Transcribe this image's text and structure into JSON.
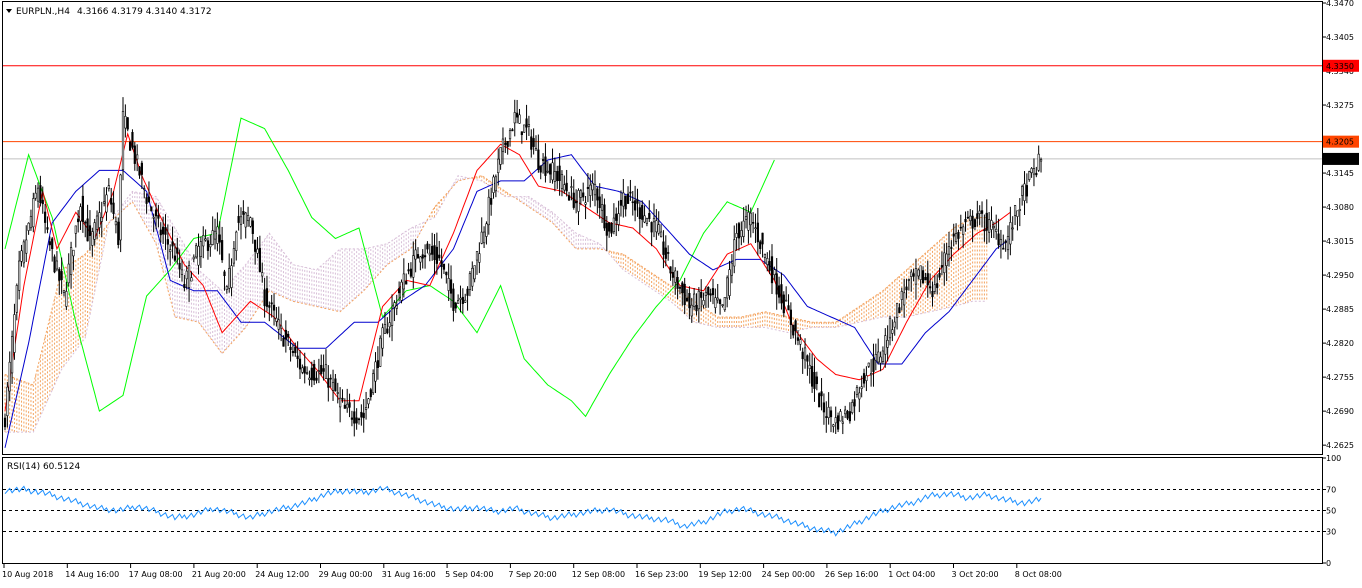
{
  "header": {
    "symbol": "EURPLN.,H4",
    "ohlc": "4.3166 4.3179 4.3140 4.3172"
  },
  "rsi_panel": {
    "label": "RSI(14) 60.5124",
    "ticks": [
      "100",
      "70",
      "50",
      "30",
      "0"
    ]
  },
  "price_axis": {
    "ticks": [
      "4.3470",
      "4.3405",
      "4.3340",
      "4.3275",
      "4.3210",
      "4.3145",
      "4.3080",
      "4.3015",
      "4.2950",
      "4.2885",
      "4.2820",
      "4.2755",
      "4.2690",
      "4.2625"
    ]
  },
  "time_axis": {
    "labels": [
      "10 Aug 2018",
      "14 Aug 16:00",
      "17 Aug 08:00",
      "21 Aug 20:00",
      "24 Aug 12:00",
      "29 Aug 00:00",
      "31 Aug 16:00",
      "5 Sep 04:00",
      "7 Sep 20:00",
      "12 Sep 08:00",
      "16 Sep 23:00",
      "19 Sep 12:00",
      "24 Sep 00:00",
      "26 Sep 16:00",
      "1 Oct 04:00",
      "3 Oct 20:00",
      "8 Oct 08:00"
    ]
  },
  "levels": [
    {
      "label": "4.3350",
      "value": 4.335,
      "color": "#ff0000"
    },
    {
      "label": "4.3205",
      "value": 4.3205,
      "color": "#ff4500"
    }
  ],
  "current_price": {
    "label": "4.3172",
    "value": 4.3172
  },
  "colors": {
    "bull_candle": "#000000",
    "bear_candle": "#000000",
    "tenkan": "#ff0000",
    "kijun": "#0000cd",
    "chikou": "#00ff00",
    "cloud_bull": "#f4a460",
    "cloud_bear": "#d8bfd8",
    "rsi": "#1e90ff",
    "level_red": "#ff0000",
    "level_orange": "#ff4500"
  },
  "chart_data": {
    "type": "candlestick",
    "symbol": "EURPLN",
    "timeframe": "H4",
    "ylim": [
      4.261,
      4.347
    ],
    "rsi_levels": [
      30,
      50,
      70
    ],
    "rsi_ylim": [
      0,
      100
    ],
    "anchors": {
      "close": [
        [
          0,
          4.268
        ],
        [
          6,
          4.296
        ],
        [
          14,
          4.312
        ],
        [
          18,
          4.302
        ],
        [
          25,
          4.291
        ],
        [
          32,
          4.309
        ],
        [
          36,
          4.301
        ],
        [
          44,
          4.311
        ],
        [
          48,
          4.302
        ],
        [
          50,
          4.325
        ],
        [
          56,
          4.316
        ],
        [
          60,
          4.31
        ],
        [
          65,
          4.304
        ],
        [
          72,
          4.299
        ],
        [
          76,
          4.293
        ],
        [
          82,
          4.3
        ],
        [
          90,
          4.303
        ],
        [
          94,
          4.291
        ],
        [
          98,
          4.305
        ],
        [
          104,
          4.306
        ],
        [
          110,
          4.291
        ],
        [
          117,
          4.284
        ],
        [
          126,
          4.277
        ],
        [
          136,
          4.276
        ],
        [
          144,
          4.269
        ],
        [
          152,
          4.268
        ],
        [
          160,
          4.283
        ],
        [
          168,
          4.293
        ],
        [
          176,
          4.3
        ],
        [
          184,
          4.298
        ],
        [
          190,
          4.29
        ],
        [
          196,
          4.292
        ],
        [
          204,
          4.306
        ],
        [
          210,
          4.318
        ],
        [
          216,
          4.325
        ],
        [
          222,
          4.322
        ],
        [
          226,
          4.317
        ],
        [
          234,
          4.314
        ],
        [
          242,
          4.309
        ],
        [
          250,
          4.312
        ],
        [
          256,
          4.303
        ],
        [
          262,
          4.31
        ],
        [
          270,
          4.307
        ],
        [
          276,
          4.304
        ],
        [
          282,
          4.296
        ],
        [
          290,
          4.289
        ],
        [
          298,
          4.291
        ],
        [
          304,
          4.288
        ],
        [
          310,
          4.303
        ],
        [
          316,
          4.306
        ],
        [
          322,
          4.299
        ],
        [
          328,
          4.292
        ],
        [
          334,
          4.285
        ],
        [
          340,
          4.278
        ],
        [
          346,
          4.27
        ],
        [
          352,
          4.267
        ],
        [
          358,
          4.269
        ],
        [
          364,
          4.276
        ],
        [
          370,
          4.279
        ],
        [
          376,
          4.286
        ],
        [
          382,
          4.293
        ],
        [
          388,
          4.295
        ],
        [
          394,
          4.292
        ],
        [
          400,
          4.301
        ],
        [
          406,
          4.304
        ],
        [
          412,
          4.306
        ],
        [
          418,
          4.304
        ],
        [
          424,
          4.301
        ],
        [
          430,
          4.309
        ],
        [
          435,
          4.314
        ],
        [
          439,
          4.317
        ]
      ],
      "tenkan": [
        [
          0,
          4.269
        ],
        [
          8,
          4.293
        ],
        [
          16,
          4.311
        ],
        [
          22,
          4.3
        ],
        [
          30,
          4.307
        ],
        [
          38,
          4.302
        ],
        [
          46,
          4.311
        ],
        [
          52,
          4.322
        ],
        [
          58,
          4.314
        ],
        [
          66,
          4.306
        ],
        [
          76,
          4.297
        ],
        [
          84,
          4.293
        ],
        [
          92,
          4.284
        ],
        [
          104,
          4.29
        ],
        [
          114,
          4.287
        ],
        [
          124,
          4.281
        ],
        [
          132,
          4.277
        ],
        [
          142,
          4.271
        ],
        [
          150,
          4.271
        ],
        [
          160,
          4.289
        ],
        [
          170,
          4.294
        ],
        [
          180,
          4.293
        ],
        [
          190,
          4.303
        ],
        [
          200,
          4.315
        ],
        [
          210,
          4.32
        ],
        [
          218,
          4.318
        ],
        [
          226,
          4.312
        ],
        [
          236,
          4.311
        ],
        [
          246,
          4.308
        ],
        [
          256,
          4.305
        ],
        [
          266,
          4.304
        ],
        [
          276,
          4.3
        ],
        [
          286,
          4.293
        ],
        [
          296,
          4.292
        ],
        [
          306,
          4.299
        ],
        [
          316,
          4.301
        ],
        [
          326,
          4.294
        ],
        [
          334,
          4.285
        ],
        [
          344,
          4.279
        ],
        [
          352,
          4.276
        ],
        [
          362,
          4.275
        ],
        [
          372,
          4.277
        ],
        [
          382,
          4.286
        ],
        [
          392,
          4.294
        ],
        [
          402,
          4.299
        ],
        [
          412,
          4.303
        ],
        [
          420,
          4.305
        ],
        [
          426,
          4.307
        ]
      ],
      "kijun": [
        [
          0,
          4.262
        ],
        [
          10,
          4.282
        ],
        [
          20,
          4.305
        ],
        [
          30,
          4.311
        ],
        [
          40,
          4.315
        ],
        [
          50,
          4.315
        ],
        [
          60,
          4.311
        ],
        [
          70,
          4.294
        ],
        [
          80,
          4.292
        ],
        [
          90,
          4.292
        ],
        [
          100,
          4.286
        ],
        [
          110,
          4.286
        ],
        [
          124,
          4.281
        ],
        [
          136,
          4.281
        ],
        [
          148,
          4.286
        ],
        [
          158,
          4.286
        ],
        [
          168,
          4.29
        ],
        [
          178,
          4.293
        ],
        [
          190,
          4.3
        ],
        [
          200,
          4.311
        ],
        [
          210,
          4.313
        ],
        [
          220,
          4.313
        ],
        [
          230,
          4.317
        ],
        [
          240,
          4.318
        ],
        [
          250,
          4.312
        ],
        [
          260,
          4.311
        ],
        [
          270,
          4.309
        ],
        [
          280,
          4.304
        ],
        [
          290,
          4.299
        ],
        [
          300,
          4.296
        ],
        [
          310,
          4.298
        ],
        [
          320,
          4.298
        ],
        [
          330,
          4.295
        ],
        [
          340,
          4.289
        ],
        [
          350,
          4.287
        ],
        [
          360,
          4.285
        ],
        [
          370,
          4.278
        ],
        [
          380,
          4.278
        ],
        [
          390,
          4.284
        ],
        [
          400,
          4.288
        ],
        [
          410,
          4.294
        ],
        [
          420,
          4.3
        ],
        [
          426,
          4.302
        ]
      ],
      "span_a": [
        [
          0,
          4.276
        ],
        [
          12,
          4.274
        ],
        [
          24,
          4.296
        ],
        [
          34,
          4.299
        ],
        [
          44,
          4.305
        ],
        [
          54,
          4.309
        ],
        [
          64,
          4.301
        ],
        [
          72,
          4.287
        ],
        [
          82,
          4.286
        ],
        [
          92,
          4.28
        ],
        [
          102,
          4.285
        ],
        [
          112,
          4.292
        ],
        [
          122,
          4.29
        ],
        [
          132,
          4.289
        ],
        [
          142,
          4.288
        ],
        [
          152,
          4.292
        ],
        [
          162,
          4.297
        ],
        [
          172,
          4.3
        ],
        [
          182,
          4.308
        ],
        [
          192,
          4.313
        ],
        [
          202,
          4.314
        ],
        [
          212,
          4.311
        ],
        [
          222,
          4.308
        ],
        [
          232,
          4.305
        ],
        [
          242,
          4.3
        ],
        [
          252,
          4.3
        ],
        [
          262,
          4.299
        ],
        [
          272,
          4.296
        ],
        [
          282,
          4.293
        ],
        [
          292,
          4.29
        ],
        [
          302,
          4.287
        ],
        [
          312,
          4.287
        ],
        [
          322,
          4.288
        ],
        [
          332,
          4.287
        ],
        [
          342,
          4.286
        ],
        [
          352,
          4.286
        ],
        [
          362,
          4.289
        ],
        [
          372,
          4.292
        ],
        [
          382,
          4.296
        ],
        [
          392,
          4.3
        ],
        [
          402,
          4.304
        ],
        [
          410,
          4.306
        ],
        [
          416,
          4.306
        ]
      ],
      "span_b": [
        [
          0,
          4.265
        ],
        [
          12,
          4.265
        ],
        [
          24,
          4.277
        ],
        [
          34,
          4.283
        ],
        [
          44,
          4.305
        ],
        [
          54,
          4.311
        ],
        [
          64,
          4.31
        ],
        [
          72,
          4.304
        ],
        [
          82,
          4.296
        ],
        [
          92,
          4.292
        ],
        [
          102,
          4.297
        ],
        [
          112,
          4.303
        ],
        [
          122,
          4.297
        ],
        [
          132,
          4.296
        ],
        [
          142,
          4.3
        ],
        [
          152,
          4.3
        ],
        [
          162,
          4.301
        ],
        [
          172,
          4.304
        ],
        [
          182,
          4.306
        ],
        [
          192,
          4.314
        ],
        [
          202,
          4.313
        ],
        [
          212,
          4.31
        ],
        [
          222,
          4.31
        ],
        [
          232,
          4.307
        ],
        [
          242,
          4.303
        ],
        [
          252,
          4.301
        ],
        [
          262,
          4.296
        ],
        [
          272,
          4.293
        ],
        [
          282,
          4.29
        ],
        [
          292,
          4.286
        ],
        [
          302,
          4.285
        ],
        [
          312,
          4.285
        ],
        [
          322,
          4.285
        ],
        [
          332,
          4.284
        ],
        [
          342,
          4.285
        ],
        [
          352,
          4.285
        ],
        [
          362,
          4.286
        ],
        [
          372,
          4.287
        ],
        [
          382,
          4.287
        ],
        [
          392,
          4.288
        ],
        [
          402,
          4.289
        ],
        [
          410,
          4.29
        ],
        [
          416,
          4.29
        ]
      ],
      "chikou": [
        [
          0,
          4.3
        ],
        [
          10,
          4.318
        ],
        [
          20,
          4.306
        ],
        [
          30,
          4.286
        ],
        [
          40,
          4.269
        ],
        [
          50,
          4.272
        ],
        [
          60,
          4.291
        ],
        [
          70,
          4.296
        ],
        [
          80,
          4.302
        ],
        [
          90,
          4.303
        ],
        [
          100,
          4.325
        ],
        [
          110,
          4.323
        ],
        [
          120,
          4.315
        ],
        [
          130,
          4.306
        ],
        [
          140,
          4.302
        ],
        [
          150,
          4.304
        ],
        [
          160,
          4.287
        ],
        [
          170,
          4.292
        ],
        [
          180,
          4.293
        ],
        [
          190,
          4.29
        ],
        [
          200,
          4.284
        ],
        [
          210,
          4.293
        ],
        [
          220,
          4.279
        ],
        [
          230,
          4.274
        ],
        [
          240,
          4.271
        ],
        [
          246,
          4.268
        ],
        [
          256,
          4.276
        ],
        [
          266,
          4.283
        ],
        [
          276,
          4.289
        ],
        [
          286,
          4.294
        ],
        [
          296,
          4.303
        ],
        [
          306,
          4.309
        ],
        [
          316,
          4.307
        ],
        [
          326,
          4.317
        ]
      ],
      "rsi": [
        [
          0,
          69
        ],
        [
          8,
          70
        ],
        [
          16,
          67
        ],
        [
          24,
          62
        ],
        [
          32,
          57
        ],
        [
          40,
          52
        ],
        [
          48,
          50
        ],
        [
          56,
          54
        ],
        [
          64,
          49
        ],
        [
          72,
          43
        ],
        [
          80,
          46
        ],
        [
          88,
          52
        ],
        [
          96,
          48
        ],
        [
          104,
          43
        ],
        [
          112,
          49
        ],
        [
          120,
          53
        ],
        [
          128,
          58
        ],
        [
          136,
          66
        ],
        [
          144,
          69
        ],
        [
          152,
          67
        ],
        [
          160,
          71
        ],
        [
          168,
          66
        ],
        [
          176,
          60
        ],
        [
          184,
          54
        ],
        [
          192,
          51
        ],
        [
          200,
          53
        ],
        [
          208,
          49
        ],
        [
          216,
          52
        ],
        [
          224,
          47
        ],
        [
          232,
          43
        ],
        [
          240,
          46
        ],
        [
          248,
          49
        ],
        [
          256,
          51
        ],
        [
          264,
          46
        ],
        [
          272,
          43
        ],
        [
          280,
          41
        ],
        [
          288,
          35
        ],
        [
          296,
          39
        ],
        [
          304,
          48
        ],
        [
          312,
          52
        ],
        [
          320,
          47
        ],
        [
          328,
          43
        ],
        [
          336,
          37
        ],
        [
          344,
          32
        ],
        [
          352,
          29
        ],
        [
          360,
          37
        ],
        [
          368,
          46
        ],
        [
          376,
          53
        ],
        [
          384,
          57
        ],
        [
          392,
          64
        ],
        [
          400,
          66
        ],
        [
          408,
          62
        ],
        [
          416,
          65
        ],
        [
          424,
          60
        ],
        [
          432,
          57
        ],
        [
          439,
          60.5
        ]
      ]
    }
  }
}
